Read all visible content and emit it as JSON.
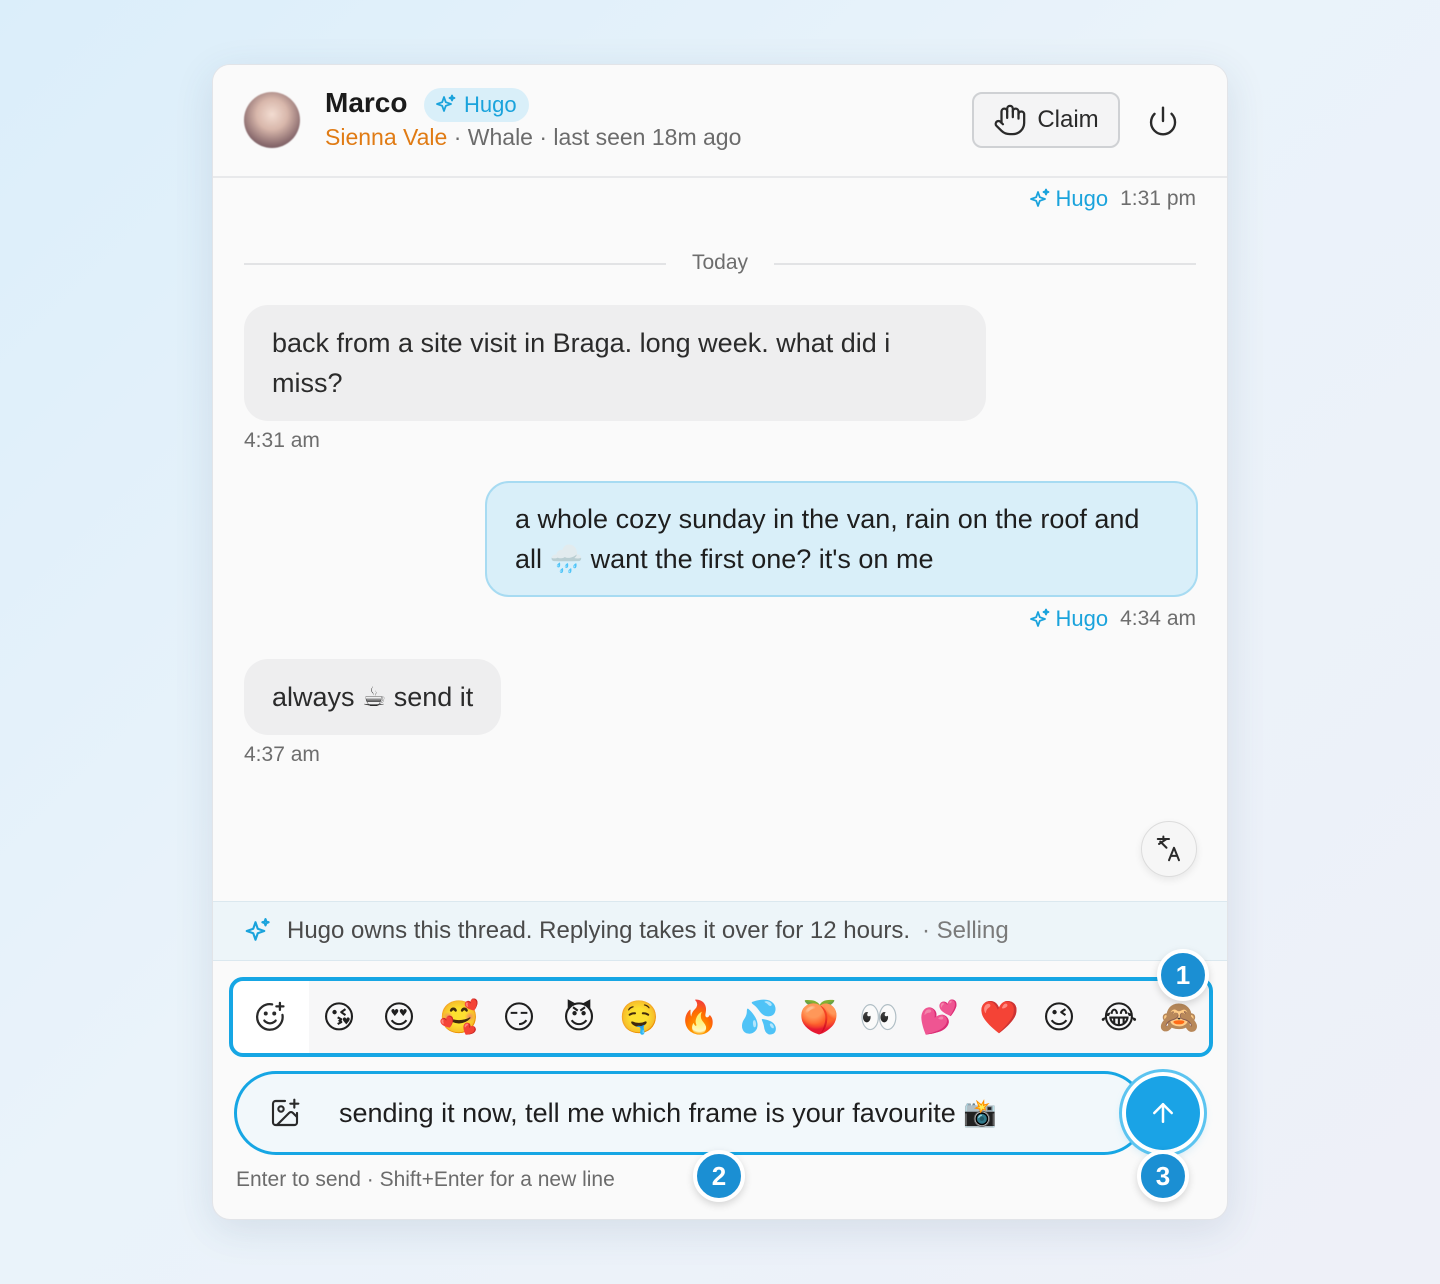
{
  "header": {
    "name": "Marco",
    "agent_pill": "Hugo",
    "brand": "Sienna Vale",
    "status": " · Whale · last seen 18m ago",
    "claim_label": "Claim"
  },
  "messages": {
    "top_meta": {
      "agent": "Hugo",
      "time": "1:31 pm"
    },
    "divider": "Today",
    "msg1": {
      "text": "back from a site visit in Braga. long week. what did i miss?",
      "time": "4:31 am"
    },
    "msg2": {
      "text": "a whole cozy sunday in the van, rain on the roof and all 🌧️ want the first one? it's on me",
      "agent": "Hugo",
      "time": "4:34 am"
    },
    "msg3": {
      "text": "always ☕ send it",
      "time": "4:37 am"
    }
  },
  "notice": {
    "text": "Hugo owns this thread. Replying takes it over for 12 hours.",
    "tag": " · Selling"
  },
  "emoji_bar": {
    "emojis": [
      "😘",
      "😍",
      "🥰",
      "😏",
      "😈",
      "🤤",
      "🔥",
      "💦",
      "🍑",
      "👀",
      "💕",
      "❤️",
      "😉",
      "😂",
      "🙈"
    ]
  },
  "compose": {
    "text": "sending it now, tell me which frame is your favourite 📸",
    "hint": "Enter to send · Shift+Enter for a new line"
  },
  "badges": [
    "1",
    "2",
    "3"
  ],
  "colors": {
    "accent": "#1aa3e6",
    "brand": "#e07b14",
    "outgoing_bubble": "#d9eff9",
    "badge": "#1b8fd3"
  }
}
